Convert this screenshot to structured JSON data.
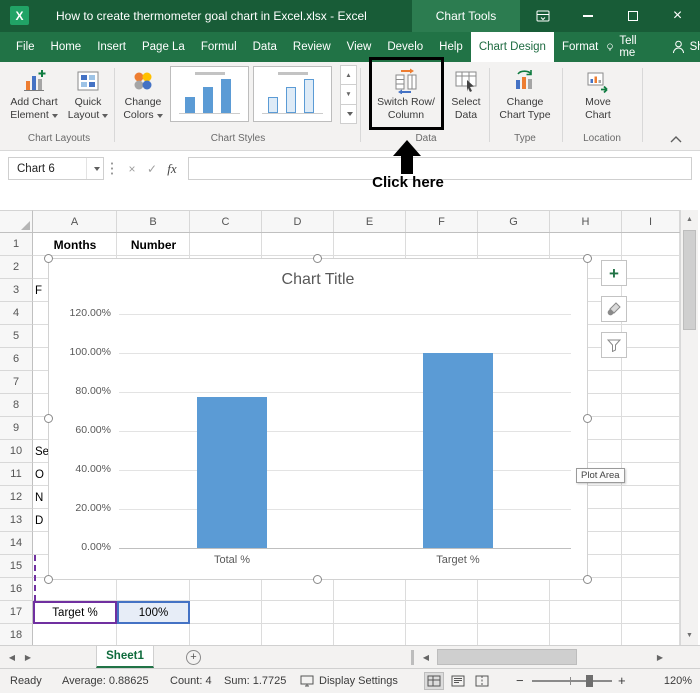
{
  "window": {
    "title": "How to create thermometer goal chart in Excel.xlsx - Excel",
    "context_tab_group": "Chart Tools"
  },
  "menu": {
    "tabs": [
      {
        "label": "File",
        "active": false
      },
      {
        "label": "Home",
        "active": false
      },
      {
        "label": "Insert",
        "active": false
      },
      {
        "label": "Page La",
        "active": false
      },
      {
        "label": "Formul",
        "active": false
      },
      {
        "label": "Data",
        "active": false
      },
      {
        "label": "Review",
        "active": false
      },
      {
        "label": "View",
        "active": false
      },
      {
        "label": "Develo",
        "active": false
      },
      {
        "label": "Help",
        "active": false
      },
      {
        "label": "Chart Design",
        "active": true
      },
      {
        "label": "Format",
        "active": false
      }
    ],
    "tell_me": "Tell me",
    "share": "Share"
  },
  "ribbon": {
    "groups": {
      "chart_layouts": "Chart Layouts",
      "chart_styles": "Chart Styles",
      "data": "Data",
      "type": "Type",
      "location": "Location"
    },
    "buttons": {
      "add_chart_element": {
        "line1": "Add Chart",
        "line2": "Element"
      },
      "quick_layout": {
        "line1": "Quick",
        "line2": "Layout"
      },
      "change_colors": {
        "line1": "Change",
        "line2": "Colors"
      },
      "switch_row_column": {
        "line1": "Switch Row/",
        "line2": "Column"
      },
      "select_data": {
        "line1": "Select",
        "line2": "Data"
      },
      "change_chart_type": {
        "line1": "Change",
        "line2": "Chart Type"
      },
      "move_chart": {
        "line1": "Move",
        "line2": "Chart"
      }
    }
  },
  "annotation": {
    "click_here": "Click here"
  },
  "formula_bar": {
    "name_box": "Chart 6",
    "cancel": "×",
    "enter": "✓",
    "fx": "fx"
  },
  "grid": {
    "column_headers": [
      "A",
      "B",
      "C",
      "D",
      "E",
      "F",
      "G",
      "H",
      "I"
    ],
    "row_count": 18,
    "cells": [
      {
        "col": 0,
        "row": 1,
        "text": "Months",
        "bold": true
      },
      {
        "col": 1,
        "row": 1,
        "text": "Number",
        "bold": true
      },
      {
        "col": 0,
        "row": 17,
        "text": "Target %",
        "style": "cat"
      },
      {
        "col": 1,
        "row": 17,
        "text": "100%",
        "style": "val"
      }
    ],
    "clipped_fragments": [
      {
        "row": 3,
        "text": "F"
      },
      {
        "row": 10,
        "text": "Se"
      },
      {
        "row": 11,
        "text": "O"
      },
      {
        "row": 12,
        "text": "N"
      },
      {
        "row": 13,
        "text": "D"
      }
    ]
  },
  "chart_data": {
    "type": "bar",
    "title": "Chart Title",
    "categories": [
      "Total %",
      "Target %"
    ],
    "values": [
      0.7725,
      1.0
    ],
    "y_ticks": [
      "120.00%",
      "100.00%",
      "80.00%",
      "60.00%",
      "40.00%",
      "20.00%",
      "0.00%"
    ],
    "ylim": [
      0,
      1.2
    ],
    "bar_color": "#5B9BD5",
    "grid": true,
    "legend": "none"
  },
  "chart_ui": {
    "tooltip": "Plot Area"
  },
  "sheet_bar": {
    "tabs": [
      {
        "label": "Sheet1",
        "active": true
      }
    ]
  },
  "status_bar": {
    "mode": "Ready",
    "average": "Average: 0.88625",
    "count": "Count: 4",
    "sum": "Sum: 1.7725",
    "display_settings": "Display Settings",
    "zoom": "120%"
  },
  "icons": {
    "excel_logo": "X",
    "close": "×",
    "plus": "+",
    "minus": "−",
    "up": "▲",
    "down": "▼",
    "left": "◀",
    "right": "▶"
  },
  "colors": {
    "titlebar_green": "#185C37",
    "ribbon_green": "#217346",
    "bar_blue": "#5B9BD5",
    "range_blue": "#4472C4",
    "range_purple": "#7030A0"
  }
}
